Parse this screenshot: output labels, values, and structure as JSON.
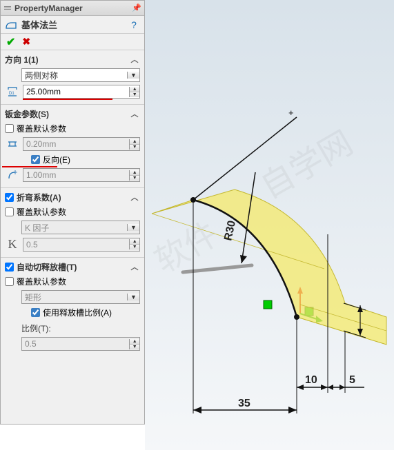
{
  "title": "PropertyManager",
  "feature_name": "基体法兰",
  "sections": {
    "direction": {
      "header": "方向 1(1)",
      "type_value": "两侧对称",
      "depth_value": "25.00mm"
    },
    "sheetmetal": {
      "header": "钣金参数(S)",
      "override_defaults": "覆盖默认参数",
      "thickness_value": "0.20mm",
      "reverse_label": "反向(E)",
      "bendradius_value": "1.00mm"
    },
    "bendallow": {
      "header": "折弯系数(A)",
      "override_defaults": "覆盖默认参数",
      "method_value": "K 因子",
      "k_value": "0.5"
    },
    "relief": {
      "header": "自动切释放槽(T)",
      "override_defaults": "覆盖默认参数",
      "type_value": "矩形",
      "use_ratio_label": "使用释放槽比例(A)",
      "ratio_label": "比例(T):",
      "ratio_value": "0.5"
    }
  },
  "viewport_dims": {
    "d1": "35",
    "d2": "10",
    "d3": "5",
    "radius": "R30"
  }
}
